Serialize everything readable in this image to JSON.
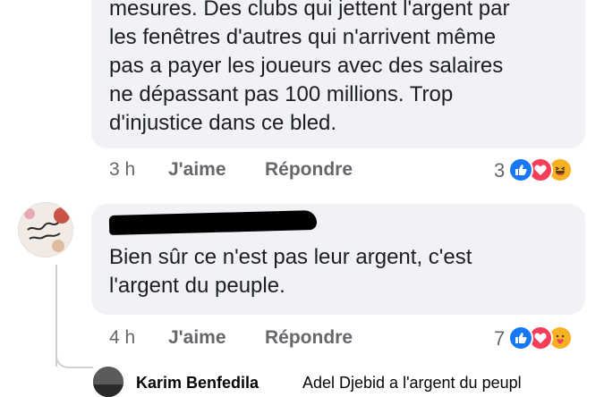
{
  "comments": [
    {
      "text_lines": [
        "mesures. Des clubs qui jettent l'argent par",
        "les fenêtres d'autres qui n'arrivent même",
        "pas a payer les joueurs avec des salaires",
        "ne dépassant pas 100 millions. Trop",
        "d'injustice dans ce bled."
      ],
      "time": "3 h",
      "like_label": "J'aime",
      "reply_label": "Répondre",
      "reaction_count": "3",
      "reactions": [
        "like-icon",
        "love-icon",
        "haha-icon"
      ]
    },
    {
      "author": "",
      "text_lines": [
        "Bien sûr ce n'est pas leur argent, c'est",
        "l'argent du peuple."
      ],
      "time": "4 h",
      "like_label": "J'aime",
      "reply_label": "Répondre",
      "reaction_count": "7",
      "reactions": [
        "like-icon",
        "love-icon",
        "care-icon"
      ]
    }
  ],
  "reply_preview": {
    "name": "Karim Benfedila",
    "text": "Adel Djebid a l'argent du peupl"
  },
  "colors": {
    "bubble": "#f0f2f5",
    "meta": "#65676b",
    "like": "#1877f2",
    "love": "#f33e58",
    "haha": "#f7b125"
  }
}
